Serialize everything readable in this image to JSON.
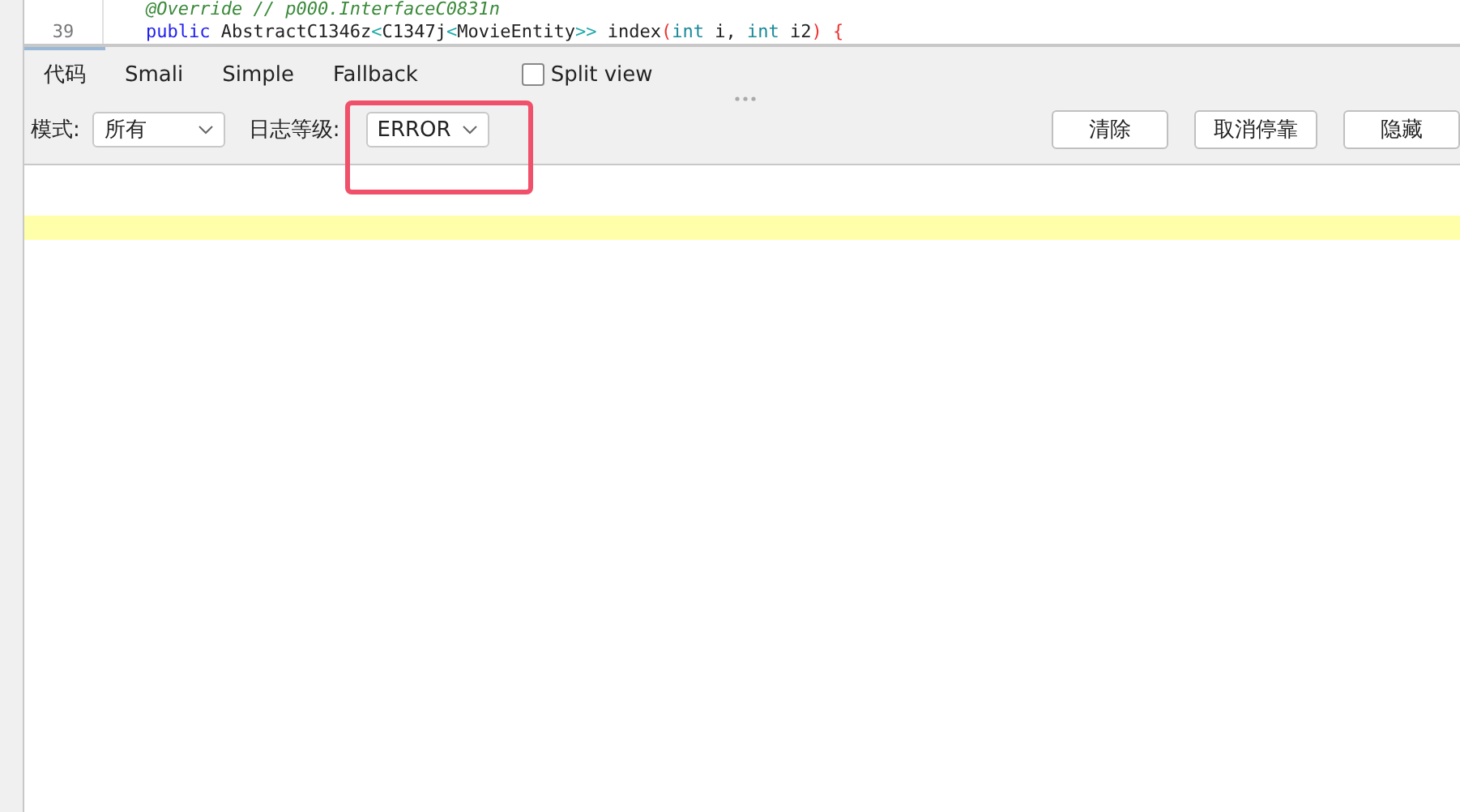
{
  "code": {
    "lines": [
      {
        "tokens": [
          {
            "kind": "comment",
            "text": "@Override // p000.InterfaceC0831n"
          }
        ]
      },
      {
        "number": "39",
        "tokens": [
          {
            "kind": "keyword",
            "text": "public"
          },
          {
            "kind": "plain",
            "text": " AbstractC1346z"
          },
          {
            "kind": "generic",
            "text": "<"
          },
          {
            "kind": "plain",
            "text": "C1347j"
          },
          {
            "kind": "generic",
            "text": "<"
          },
          {
            "kind": "plain",
            "text": "MovieEntity"
          },
          {
            "kind": "generic",
            "text": ">>"
          },
          {
            "kind": "plain",
            "text": " index"
          },
          {
            "kind": "paren",
            "text": "("
          },
          {
            "kind": "type",
            "text": "int"
          },
          {
            "kind": "plain",
            "text": " i, "
          },
          {
            "kind": "type",
            "text": "int"
          },
          {
            "kind": "plain",
            "text": " i2"
          },
          {
            "kind": "paren",
            "text": ") {"
          }
        ]
      }
    ]
  },
  "tabs": [
    {
      "label": "代码",
      "selected": true
    },
    {
      "label": "Smali",
      "selected": false
    },
    {
      "label": "Simple",
      "selected": false
    },
    {
      "label": "Fallback",
      "selected": false
    }
  ],
  "split_view": {
    "label": "Split view",
    "checked": false
  },
  "toolbar": {
    "mode": {
      "label": "模式:",
      "value": "所有"
    },
    "log_level": {
      "label": "日志等级:",
      "value": "ERROR",
      "highlighted": true
    },
    "buttons": [
      "清除",
      "取消停靠",
      "隐藏"
    ]
  },
  "log": {
    "highlighted_row": true
  }
}
